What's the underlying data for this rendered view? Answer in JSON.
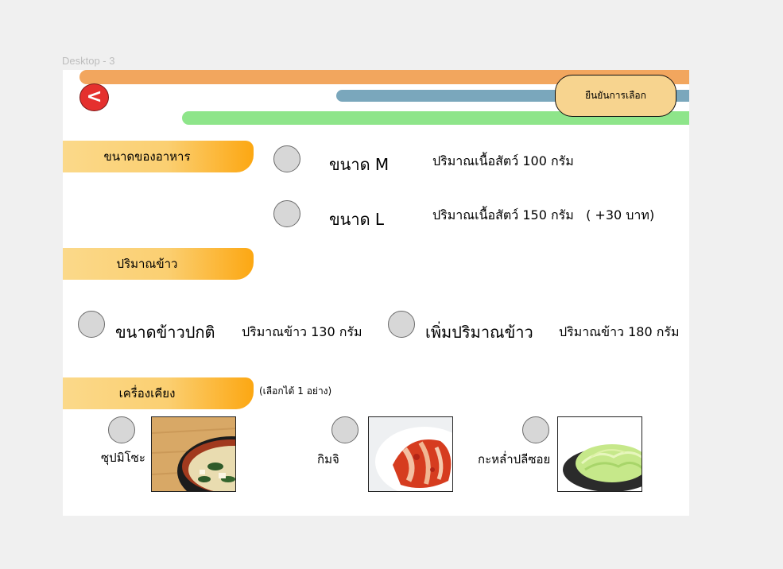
{
  "frame": {
    "label": "Desktop - 3"
  },
  "header": {
    "back_label": "<",
    "confirm_label": "ยืนยันการเลือก"
  },
  "sections": {
    "size": {
      "title": "ขนาดของอาหาร",
      "options": [
        {
          "label": "ขนาด M",
          "detail": "ปริมาณเนื้อสัตว์ 100 กรัม"
        },
        {
          "label": "ขนาด L",
          "detail": "ปริมาณเนื้อสัตว์ 150 กรัม   ( +30 บาท)"
        }
      ]
    },
    "rice": {
      "title": "ปริมาณข้าว",
      "options": [
        {
          "label": "ขนาดข้าวปกติ",
          "detail": "ปริมาณข้าว 130 กรัม"
        },
        {
          "label": "เพิ่มปริมาณข้าว",
          "detail": "ปริมาณข้าว 180 กรัม"
        }
      ]
    },
    "side": {
      "title": "เครื่องเคียง",
      "note": "(เลือกได้ 1 อย่าง)",
      "options": [
        {
          "label": "ซุปมิโซะ",
          "image_icon": "miso-soup-photo"
        },
        {
          "label": "กิมจิ",
          "image_icon": "kimchi-photo"
        },
        {
          "label": "กะหล่ำปลีซอย",
          "image_icon": "shredded-cabbage-photo"
        }
      ]
    }
  },
  "colors": {
    "bar_orange": "#f2a65e",
    "bar_blue": "#7aa7bc",
    "bar_green": "#8ee58a",
    "back_button": "#e5302e",
    "confirm_button": "#f7d48f",
    "tab_gradient_end": "#fca712",
    "radio_fill": "#d7d7d7"
  }
}
